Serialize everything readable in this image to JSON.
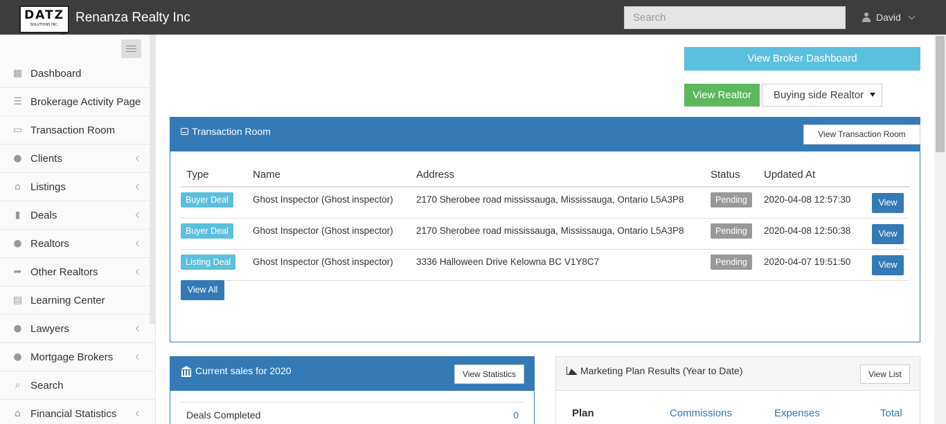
{
  "header": {
    "logo_text": "DATZ",
    "logo_sub": "SOLUTIONS INC.",
    "app_title": "Renanza Realty Inc",
    "search_placeholder": "Search",
    "user_name": "David"
  },
  "sidebar": {
    "items": [
      {
        "label": "Dashboard",
        "icon": "calendar-icon",
        "has_arrow": false
      },
      {
        "label": "Brokerage Activity Page",
        "icon": "list-icon",
        "has_arrow": false
      },
      {
        "label": "Transaction Room",
        "icon": "inbox-icon",
        "has_arrow": false
      },
      {
        "label": "Clients",
        "icon": "user-icon",
        "has_arrow": true
      },
      {
        "label": "Listings",
        "icon": "home-icon",
        "has_arrow": true
      },
      {
        "label": "Deals",
        "icon": "file-icon",
        "has_arrow": true
      },
      {
        "label": "Realtors",
        "icon": "users-icon",
        "has_arrow": true
      },
      {
        "label": "Other Realtors",
        "icon": "share-icon",
        "has_arrow": true
      },
      {
        "label": "Learning Center",
        "icon": "book-icon",
        "has_arrow": false
      },
      {
        "label": "Lawyers",
        "icon": "users-icon",
        "has_arrow": true
      },
      {
        "label": "Mortgage Brokers",
        "icon": "users-icon",
        "has_arrow": true
      },
      {
        "label": "Search",
        "icon": "search-icon",
        "has_arrow": false
      },
      {
        "label": "Financial Statistics",
        "icon": "bank-icon",
        "has_arrow": true
      }
    ]
  },
  "actions": {
    "broker_dashboard": "View Broker Dashboard",
    "view_realtor": "View Realtor",
    "realtor_select": "Buying side Realtor"
  },
  "transaction_room": {
    "title": "Transaction Room",
    "view_button": "View Transaction Room",
    "columns": [
      "Type",
      "Name",
      "Address",
      "Status",
      "Updated At"
    ],
    "rows": [
      {
        "type": "Buyer Deal",
        "name": "Ghost Inspector (Ghost inspector)",
        "address": "2170 Sherobee road mississauga, Mississauga, Ontario L5A3P8",
        "status": "Pending",
        "updated": "2020-04-08 12:57:30",
        "action": "View"
      },
      {
        "type": "Buyer Deal",
        "name": "Ghost Inspector (Ghost inspector)",
        "address": "2170 Sherobee road mississauga, Mississauga, Ontario L5A3P8",
        "status": "Pending",
        "updated": "2020-04-08 12:50:38",
        "action": "View"
      },
      {
        "type": "Listing Deal",
        "name": "Ghost Inspector (Ghost inspector)",
        "address": "3336 Halloween Drive Kelowna BC V1Y8C7",
        "status": "Pending",
        "updated": "2020-04-07 19:51:50",
        "action": "View"
      }
    ],
    "view_all": "View All"
  },
  "current_sales": {
    "title": "Current sales for 2020",
    "view_button": "View Statistics",
    "deals_label": "Deals Completed",
    "deals_value": "0"
  },
  "marketing": {
    "title": "Marketing Plan Results (Year to Date)",
    "view_button": "View List",
    "columns": [
      "Plan",
      "Commissions",
      "Expenses",
      "Total"
    ]
  }
}
